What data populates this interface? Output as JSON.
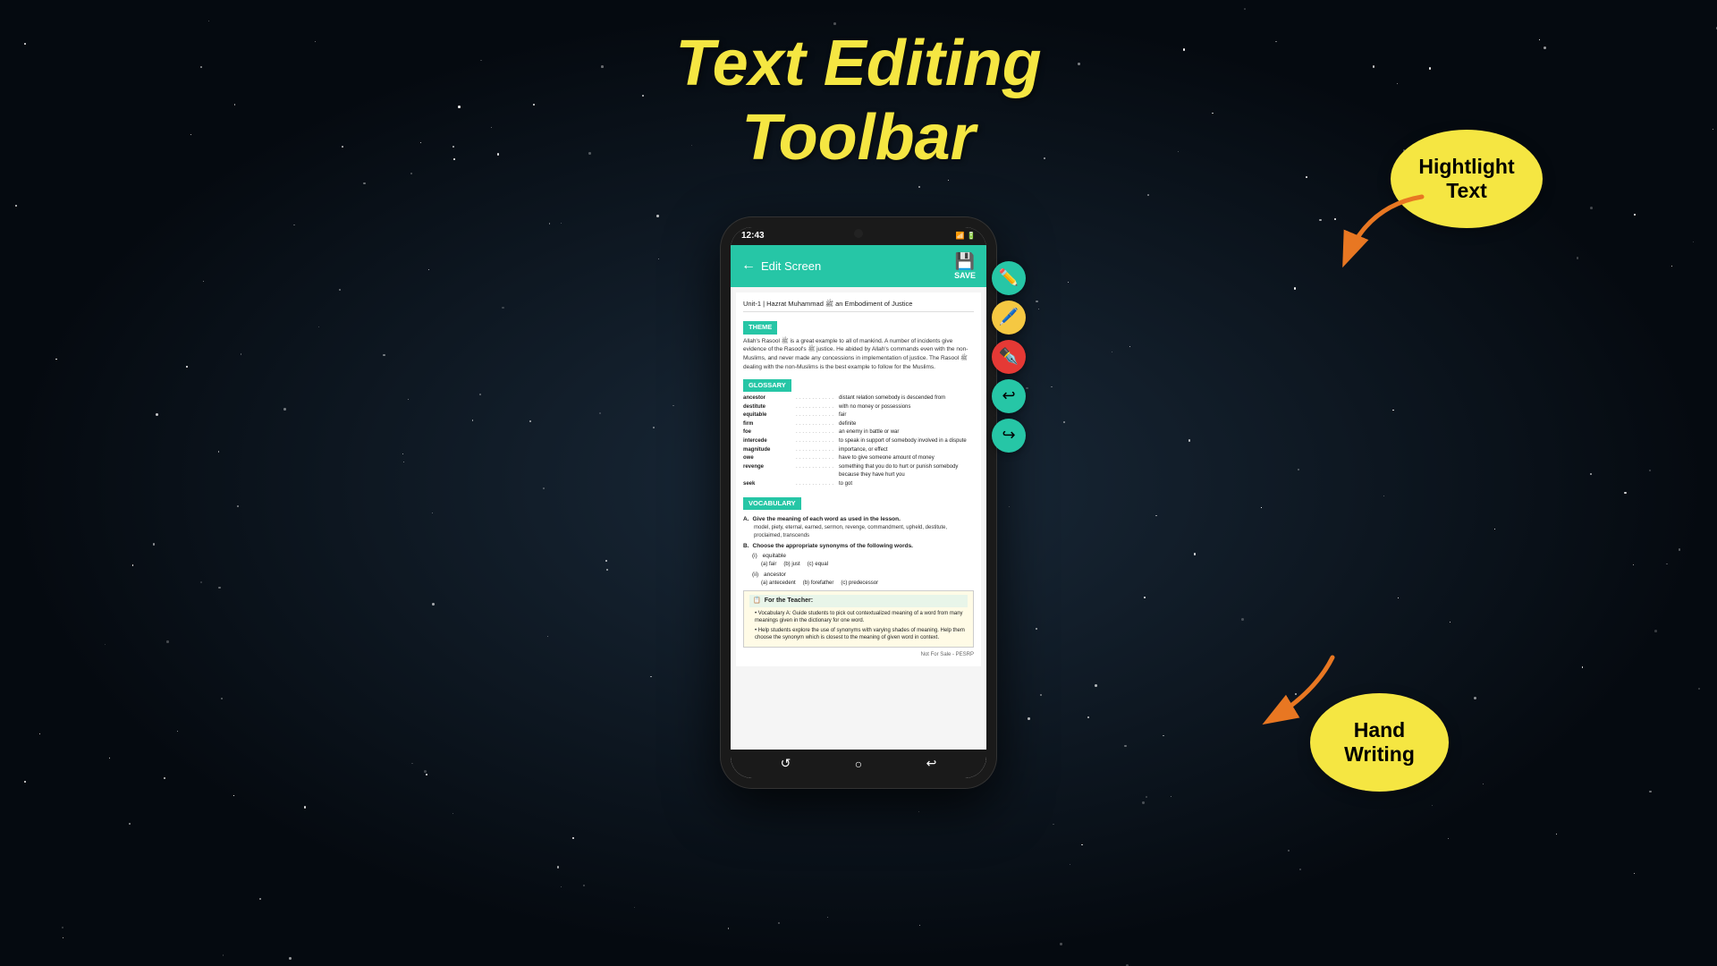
{
  "background": {
    "color": "#0a0f1a"
  },
  "title": {
    "line1": "Text Editing",
    "line2": "Toolbar",
    "color": "#f5e642"
  },
  "phone": {
    "status_bar": {
      "time": "12:43",
      "icons": "📶🔋"
    },
    "header": {
      "back_label": "Edit Screen",
      "save_label": "SAVE"
    },
    "document": {
      "unit_header": "Unit-1 | Hazrat Muhammad ﷺ an Embodiment of Justice",
      "theme_label": "THEME",
      "theme_text": "Allah's Rasool ﷺ is a great example to all of mankind. A number of incidents give evidence of the Rasool's ﷺ justice. He abided by Allah's commands even with the non-Muslims, and never made any concessions in implementation of justice. The Rasool ﷺ dealing with the non-Muslims is the best example to follow for the Muslims.",
      "glossary_label": "GLOSSARY",
      "glossary_items": [
        {
          "word": "ancestor",
          "dots": "............",
          "def": "distant relation somebody is descended from"
        },
        {
          "word": "destitute",
          "dots": "............",
          "def": "with no money or possessions"
        },
        {
          "word": "equitable",
          "dots": "............",
          "def": "fair"
        },
        {
          "word": "firm",
          "dots": "............",
          "def": "definite"
        },
        {
          "word": "foe",
          "dots": "............",
          "def": "an enemy in battle or war"
        },
        {
          "word": "intercede",
          "dots": "............",
          "def": "to speak in support of somebody involved in a dispute"
        },
        {
          "word": "magnitude",
          "dots": "............",
          "def": "importance, or effect"
        },
        {
          "word": "owe",
          "dots": "............",
          "def": "have to give someone amount of money"
        },
        {
          "word": "revenge",
          "dots": "............",
          "def": "something that you do to hurt or punish somebody because they have hurt you"
        },
        {
          "word": "seek",
          "dots": "............",
          "def": "to got"
        }
      ],
      "vocab_label": "VOCABULARY",
      "vocab_a_label": "A.",
      "vocab_a_instruction": "Give the meaning of each word as used in the lesson.",
      "vocab_a_words": "model, piety, eternal, earned, sermon, revenge, commandment, upheld, destitute, proclaimed, transcends",
      "vocab_b_label": "B.",
      "vocab_b_instruction": "Choose the appropriate synonyms of the following words.",
      "vocab_b_items": [
        {
          "num": "(i)",
          "word": "equitable",
          "options": [
            "(a) fair",
            "(b) just",
            "(c) equal"
          ]
        },
        {
          "num": "(ii)",
          "word": "ancestor",
          "options": [
            "(a) antecedent",
            "(b) forefather",
            "(c) predecessor"
          ]
        }
      ],
      "teacher_label": "For the Teacher:",
      "teacher_bullets": [
        "Vocabulary A: Guide students to pick out contextualized meaning of a word from many meanings given in the dictionary for one word.",
        "Help students explore the use of synonyms with varying shades of meaning. Help them choose the synonym which is closest to the meaning of given word in context."
      ],
      "footer": "Not For Sale - PESRP"
    },
    "toolbar_buttons": [
      {
        "id": "highlight",
        "color": "teal",
        "icon": "✏️"
      },
      {
        "id": "marker",
        "color": "yellow",
        "icon": "🖊️"
      },
      {
        "id": "pen-red",
        "color": "red",
        "icon": "✒️"
      },
      {
        "id": "undo",
        "color": "teal",
        "icon": "↩️"
      },
      {
        "id": "redo",
        "color": "teal",
        "icon": "↪️"
      }
    ],
    "bottom_buttons": [
      "↺",
      "○",
      "↩"
    ]
  },
  "callouts": {
    "highlight": {
      "text": "Hightlight\nText",
      "color": "#f5e642"
    },
    "handwriting": {
      "text": "Hand\nWriting",
      "color": "#f5e642"
    }
  }
}
